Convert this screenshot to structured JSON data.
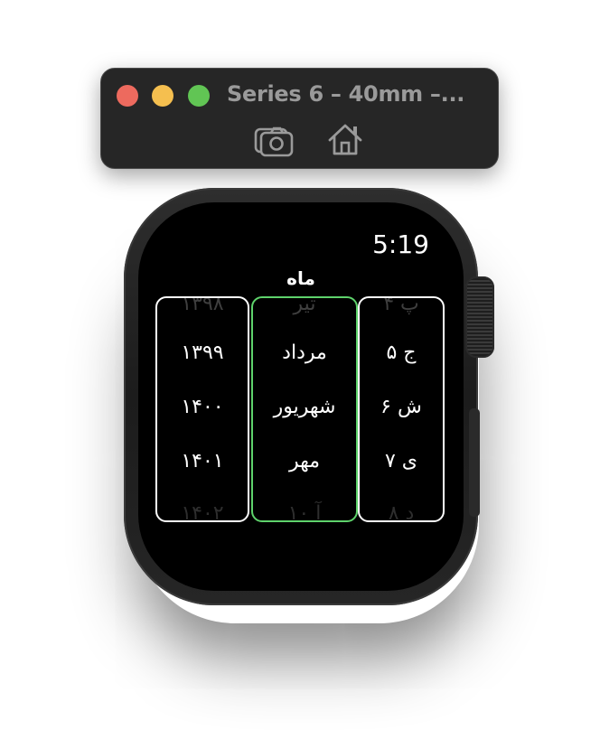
{
  "window": {
    "title": "Series 6 – 40mm –..."
  },
  "toolbar": {
    "icons": [
      "screenshot-camera-icon",
      "home-icon"
    ]
  },
  "watch": {
    "time": "5:19",
    "title": "ماه",
    "year_column": {
      "items": [
        "۱۳۹۸",
        "۱۳۹۹",
        "۱۴۰۰",
        "۱۴۰۱",
        "۱۴۰۲"
      ]
    },
    "month_column": {
      "items": [
        "تیر",
        "مرداد",
        "شهریور",
        "مهر",
        "۱۰ آ"
      ]
    },
    "day_column": {
      "items": [
        "پ ۴",
        "ج ۵",
        "ش ۶",
        "ی ۷",
        "د ۸"
      ]
    },
    "colors": {
      "focus_ring": "#5ed26b",
      "screen_background": "#000000"
    }
  }
}
